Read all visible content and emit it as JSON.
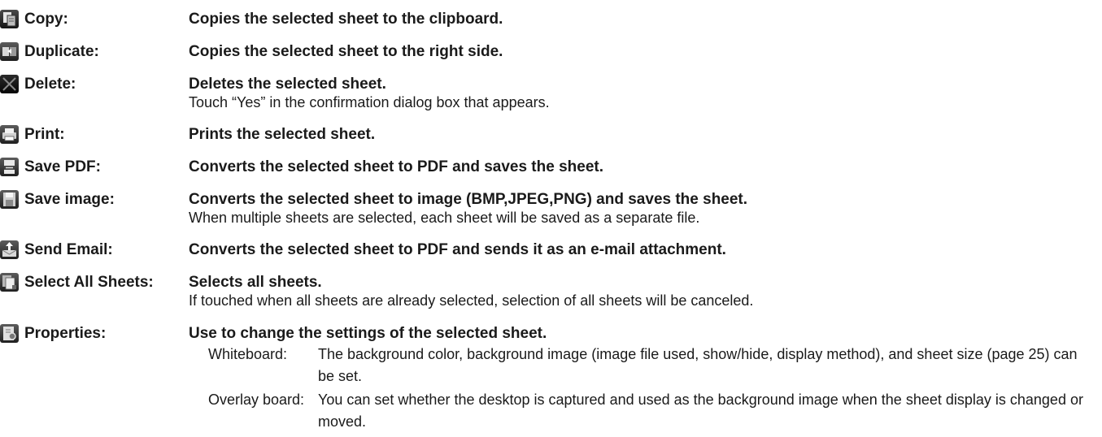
{
  "items": [
    {
      "icon": "copy-icon",
      "label": "Copy:",
      "desc": "Copies the selected sheet to the clipboard."
    },
    {
      "icon": "duplicate-icon",
      "label": "Duplicate:",
      "desc": "Copies the selected sheet to the right side."
    },
    {
      "icon": "delete-icon",
      "label": "Delete:",
      "desc": "Deletes the selected sheet.",
      "note": "Touch “Yes” in the confirmation dialog box that appears."
    },
    {
      "icon": "print-icon",
      "label": "Print:",
      "desc": "Prints the selected sheet."
    },
    {
      "icon": "save-pdf-icon",
      "label": "Save PDF:",
      "desc": "Converts the selected sheet to PDF and saves the sheet."
    },
    {
      "icon": "save-image-icon",
      "label": "Save image:",
      "desc": "Converts the selected sheet to image (BMP,JPEG,PNG) and saves the sheet.",
      "note": "When multiple sheets are selected, each sheet will be saved as a separate file."
    },
    {
      "icon": "send-email-icon",
      "label": "Send Email:",
      "desc": "Converts the selected sheet to PDF and sends it as an e-mail attachment."
    },
    {
      "icon": "select-all-sheets-icon",
      "label": "Select All Sheets:",
      "desc": "Selects all sheets.",
      "note": "If touched when all sheets are already selected, selection of all sheets will be canceled."
    },
    {
      "icon": "properties-icon",
      "label": "Properties:",
      "desc": "Use to change the settings of the selected sheet.",
      "sub": [
        {
          "label": "Whiteboard:",
          "text": "The background color, background image (image file used, show/hide, display method), and sheet size (page 25) can be set."
        },
        {
          "label": "Overlay board:",
          "text": "You can set whether the desktop is captured and used as the background image when the sheet display is changed or moved."
        }
      ]
    }
  ],
  "icon_color": "#2e2e2e"
}
